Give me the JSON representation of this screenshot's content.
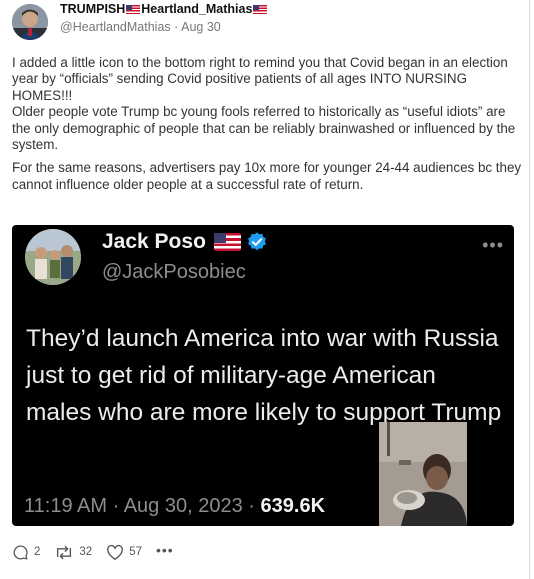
{
  "post": {
    "display_name_prefix": "TRUMPISH",
    "display_name_mid": "Heartland_Mathias",
    "handle": "@HeartlandMathias",
    "separator": "·",
    "date": "Aug 30",
    "body_paragraphs": [
      "I added a little icon to the bottom right to remind you that Covid began in an election year by “officials” sending Covid positive patients of all ages INTO NURSING HOMES!!!",
      "Older people vote Trump bc young fools referred to historically as “useful idiots” are the only demographic of people that can be reliably brainwashed or influenced by the system.",
      "For the same reasons, advertisers pay 10x more for younger 24-44 audiences bc they cannot influence older people at a successful rate of return."
    ]
  },
  "embed": {
    "name": "Jack Poso",
    "handle": "@JackPosobiec",
    "text": "They’d launch America into war with Russia just to get rid of military-age American males who are more likely to support Trump",
    "time": "11:19 AM",
    "separator": "·",
    "date": "Aug 30, 2023",
    "separator2": "·",
    "views": "639.6K",
    "more_icon": "ellipsis-icon",
    "verified_icon": "verified-badge-icon"
  },
  "actions": {
    "replies": "2",
    "reposts": "32",
    "likes": "57",
    "reply_icon": "comment-icon",
    "repost_icon": "repost-icon",
    "like_icon": "heart-icon",
    "more_icon": "ellipsis-icon"
  },
  "colors": {
    "verified": "#1d9bf0",
    "embed_bg": "#000000",
    "text": "#333333"
  }
}
